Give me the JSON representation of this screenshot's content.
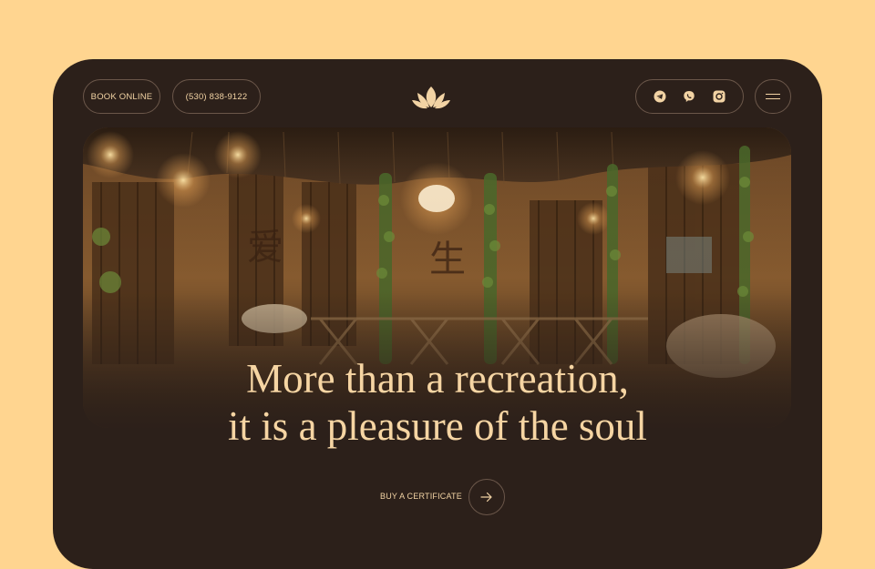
{
  "header": {
    "book_label": "BOOK ONLINE",
    "phone": "(530) 838-9122",
    "logo_icon": "lotus-icon",
    "social": [
      "telegram-icon",
      "viber-icon",
      "instagram-icon"
    ],
    "menu_icon": "hamburger-menu-icon"
  },
  "hero": {
    "image": "spa-interior-photo",
    "headline_line1": "More than a recreation,",
    "headline_line2": "it is a pleasure of the soul"
  },
  "cta": {
    "label": "BUY A CERTIFICATE",
    "icon": "arrow-right-icon"
  },
  "colors": {
    "page_background": "#FFD590",
    "card_background": "#2C201A",
    "accent": "#F2D3A4",
    "border": "#6b574a"
  }
}
